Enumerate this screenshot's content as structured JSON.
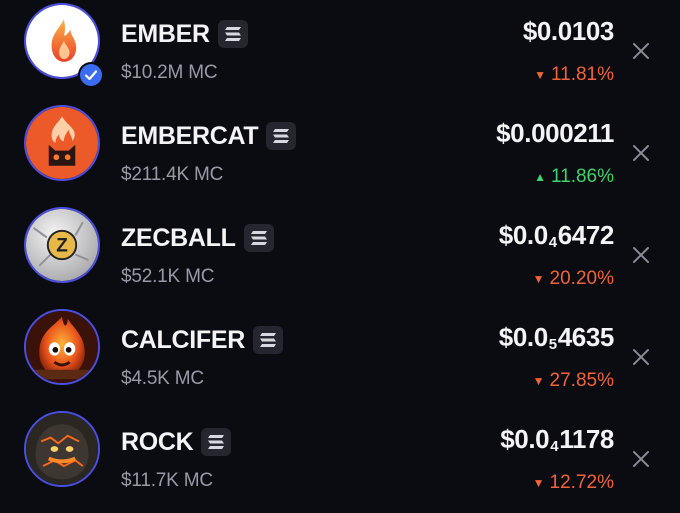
{
  "tokens": [
    {
      "name": "EMBER",
      "market_cap": "$10.2M MC",
      "price_prefix": "$0.0103",
      "price_subscript": "",
      "price_suffix": "",
      "change": "11.81%",
      "direction": "down",
      "verified": true,
      "icon": "flame-logo-icon"
    },
    {
      "name": "EMBERCAT",
      "market_cap": "$211.4K MC",
      "price_prefix": "$0.000211",
      "price_subscript": "",
      "price_suffix": "",
      "change": "11.86%",
      "direction": "up",
      "verified": false,
      "icon": "fire-cat-icon"
    },
    {
      "name": "ZECBALL",
      "market_cap": "$52.1K MC",
      "price_prefix": "$0.0",
      "price_subscript": "4",
      "price_suffix": "6472",
      "change": "20.20%",
      "direction": "down",
      "verified": false,
      "icon": "zcash-ball-icon"
    },
    {
      "name": "CALCIFER",
      "market_cap": "$4.5K MC",
      "price_prefix": "$0.0",
      "price_subscript": "5",
      "price_suffix": "4635",
      "change": "27.85%",
      "direction": "down",
      "verified": false,
      "icon": "fire-demon-icon"
    },
    {
      "name": "ROCK",
      "market_cap": "$11.7K MC",
      "price_prefix": "$0.0",
      "price_subscript": "4",
      "price_suffix": "1178",
      "change": "12.72%",
      "direction": "down",
      "verified": false,
      "icon": "lava-rock-icon"
    }
  ],
  "colors": {
    "background": "#0b0b12",
    "down": "#f0643a",
    "up": "#3fd46a",
    "muted_text": "#9a9aa6",
    "avatar_ring": "#4b4fe0",
    "verified_badge": "#3b6cf0"
  },
  "chain_icon": "solana-chain-icon",
  "remove_icon": "close-icon"
}
